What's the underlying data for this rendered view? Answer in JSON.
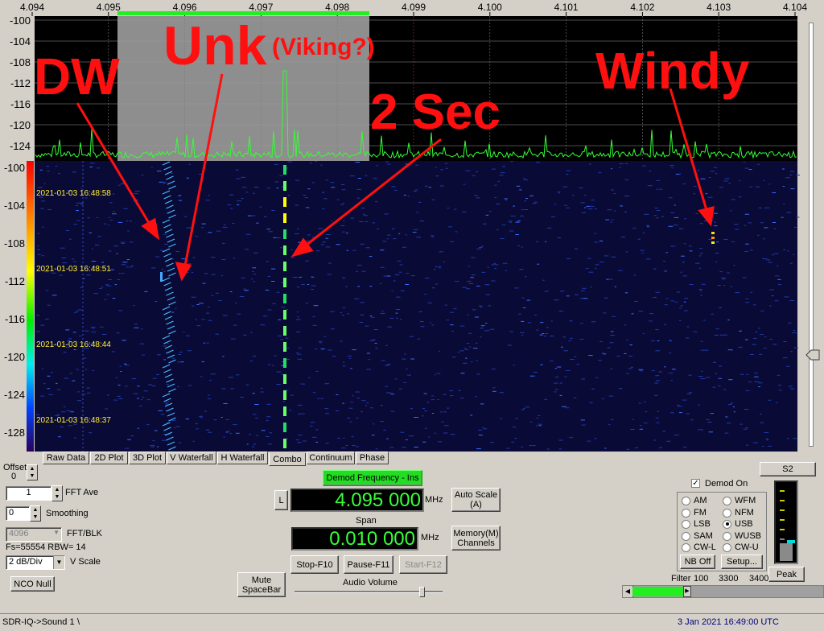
{
  "freq_axis": {
    "labels": [
      "4.094",
      "4.095",
      "4.096",
      "4.097",
      "4.098",
      "4.099",
      "4.100",
      "4.101",
      "4.102",
      "4.103",
      "4.104"
    ]
  },
  "spectrum": {
    "db_labels": [
      "-100",
      "-104",
      "-108",
      "-112",
      "-116",
      "-120",
      "-124"
    ]
  },
  "waterfall": {
    "db_labels": [
      "-100",
      "-104",
      "-108",
      "-112",
      "-116",
      "-120",
      "-124",
      "-128"
    ],
    "timestamps": [
      "2021-01-03 16:48:58",
      "2021-01-03 16:48:51",
      "2021-01-03 16:48:44",
      "2021-01-03 16:48:37"
    ]
  },
  "annotations": {
    "dw": "DW",
    "unk": "Unk",
    "viking": "(Viking?)",
    "two_sec": "2 Sec",
    "windy": "Windy"
  },
  "tabs": [
    "Raw Data",
    "2D Plot",
    "3D Plot",
    "V Waterfall",
    "H Waterfall",
    "Combo",
    "Continuum",
    "Phase"
  ],
  "active_tab": "Combo",
  "left_controls": {
    "offset_label": "Offset",
    "offset_value": "0",
    "fft_ave_value": "1",
    "fft_ave_label": "FFT Ave",
    "smoothing_value": "0",
    "smoothing_label": "Smoothing",
    "fft_blk_value": "4096",
    "fft_blk_label": "FFT/BLK",
    "fs_text": "Fs=55554 RBW= 14",
    "vscale_value": "2 dB/Div",
    "vscale_label": "V Scale",
    "nco_null": "NCO Null"
  },
  "center_controls": {
    "demod_freq_button": "Demod Frequency - Ins",
    "l_button": "L",
    "frequency_value": "4.095 000",
    "frequency_unit": "MHz",
    "auto_scale": "Auto Scale (A)",
    "span_label": "Span",
    "span_value": "0.010 000",
    "span_unit": "MHz",
    "memory_channels": "Memory(M) Channels",
    "mute": "Mute SpaceBar",
    "stop": "Stop-F10",
    "pause": "Pause-F11",
    "start": "Start-F12",
    "audio_volume": "Audio Volume"
  },
  "right_controls": {
    "s2_button": "S2",
    "demod_on": "Demod On",
    "modes": [
      "AM",
      "WFM",
      "FM",
      "NFM",
      "LSB",
      "USB",
      "SAM",
      "WUSB",
      "CW-L",
      "CW-U"
    ],
    "selected_mode": "USB",
    "nb_off": "NB Off",
    "setup": "Setup...",
    "peak": "Peak",
    "filter_label": "Filter",
    "filter_values": [
      "100",
      "3300",
      "3400"
    ],
    "filter_slider_fill": 0.3
  },
  "status_bar": {
    "left": "SDR-IQ->Sound 1",
    "separator": "\\",
    "right": "3 Jan 2021   16:49:00 UTC"
  }
}
